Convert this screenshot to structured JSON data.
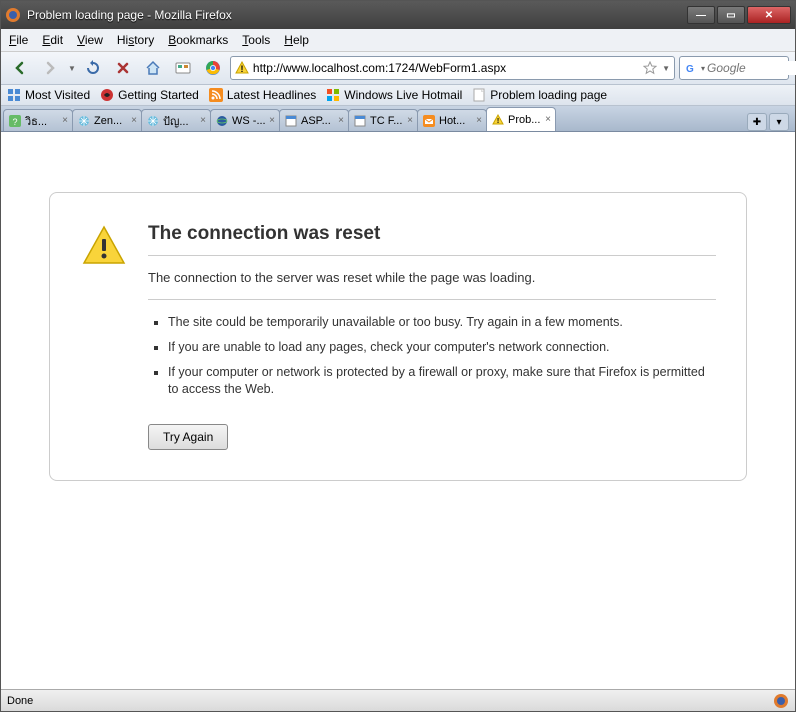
{
  "window": {
    "title": "Problem loading page - Mozilla Firefox"
  },
  "menu": {
    "file": "File",
    "edit": "Edit",
    "view": "View",
    "history": "History",
    "bookmarks": "Bookmarks",
    "tools": "Tools",
    "help": "Help"
  },
  "toolbar": {
    "url": "http://www.localhost.com:1724/WebForm1.aspx",
    "search_placeholder": "Google"
  },
  "bookmarks": {
    "most_visited": "Most Visited",
    "getting_started": "Getting Started",
    "latest_headlines": "Latest Headlines",
    "windows_live": "Windows Live Hotmail",
    "problem_loading": "Problem loading page"
  },
  "tabs": [
    {
      "label": "วิธ..."
    },
    {
      "label": "Zen..."
    },
    {
      "label": "ปัญ..."
    },
    {
      "label": "WS -..."
    },
    {
      "label": "ASP..."
    },
    {
      "label": "TC F..."
    },
    {
      "label": "Hot..."
    },
    {
      "label": "Prob..."
    }
  ],
  "error": {
    "title": "The connection was reset",
    "desc": "The connection to the server was reset while the page was loading.",
    "items": [
      "The site could be temporarily unavailable or too busy. Try again in a few moments.",
      "If you are unable to load any pages, check your computer's network connection.",
      "If your computer or network is protected by a firewall or proxy, make sure that Firefox is permitted to access the Web."
    ],
    "try_again": "Try Again"
  },
  "status": {
    "text": "Done"
  }
}
